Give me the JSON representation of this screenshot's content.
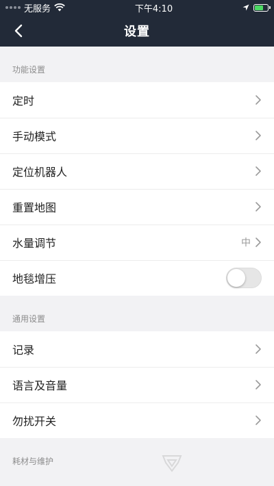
{
  "status_bar": {
    "carrier": "无服务",
    "time": "下午4:10"
  },
  "nav": {
    "title": "设置",
    "back_icon": "chevron-left-icon"
  },
  "sections": [
    {
      "header": "功能设置",
      "items": [
        {
          "label": "定时",
          "type": "link"
        },
        {
          "label": "手动模式",
          "type": "link"
        },
        {
          "label": "定位机器人",
          "type": "link"
        },
        {
          "label": "重置地图",
          "type": "link"
        },
        {
          "label": "水量调节",
          "type": "link",
          "value": "中"
        },
        {
          "label": "地毯增压",
          "type": "toggle",
          "on": false
        }
      ]
    },
    {
      "header": "通用设置",
      "items": [
        {
          "label": "记录",
          "type": "link"
        },
        {
          "label": "语言及音量",
          "type": "link"
        },
        {
          "label": "勿扰开关",
          "type": "link"
        }
      ]
    },
    {
      "header": "耗材与维护",
      "items": []
    }
  ],
  "colors": {
    "header_bg": "#222a38",
    "page_bg": "#f2f2f4",
    "battery_fill": "#4cd964"
  }
}
